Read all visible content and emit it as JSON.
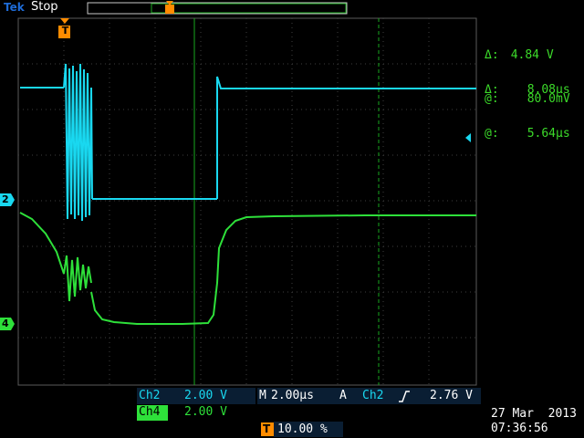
{
  "header": {
    "brand": "Tek",
    "status": "Stop",
    "trigger_marker": "T"
  },
  "cursor_readout": {
    "line1_label": "Δ:",
    "line1_value": "4.84 V",
    "line2_label": "@:",
    "line2_value": "80.0mV",
    "line3_label": "Δ:",
    "line3_value": "8.08µs",
    "line4_label": "@:",
    "line4_value": "5.64µs"
  },
  "channels": {
    "ch2": {
      "marker": "2",
      "label": "Ch2",
      "scale": "2.00 V",
      "color": "#19d8f0"
    },
    "ch4": {
      "marker": "4",
      "label": "Ch4",
      "scale": "2.00 V",
      "color": "#2ee03a"
    }
  },
  "timebase": {
    "m_label": "M",
    "m_value": "2.00µs"
  },
  "trigger": {
    "a_label": "A",
    "source": "Ch2",
    "slope_icon": "rising-edge-icon",
    "level": "2.76 V"
  },
  "trigger_position": {
    "icon_letter": "T",
    "value": "10.00 %"
  },
  "datetime": {
    "date": "27 Mar  2013",
    "time": "07:36:56"
  },
  "colors": {
    "grid": "#4a4a4a",
    "cursor": "#17a11a",
    "accent_orange": "#ff8c00",
    "status_bar": "#0a2c5a"
  }
}
